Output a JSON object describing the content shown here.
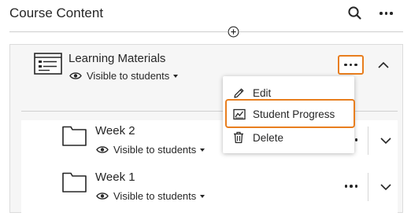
{
  "header": {
    "title": "Course Content",
    "search_icon": "search-icon",
    "more_icon": "more-options-icon"
  },
  "folder": {
    "title": "Learning Materials",
    "visibility": "Visible to students",
    "icon": "folder-content-icon",
    "expanded": true
  },
  "menu": {
    "items": [
      {
        "label": "Edit",
        "icon": "pencil-icon"
      },
      {
        "label": "Student Progress",
        "icon": "student-progress-icon",
        "highlighted": true
      },
      {
        "label": "Delete",
        "icon": "trash-icon"
      }
    ]
  },
  "items": [
    {
      "title": "Week 2",
      "visibility": "Visible to students",
      "icon": "folder-icon"
    },
    {
      "title": "Week 1",
      "visibility": "Visible to students",
      "icon": "folder-icon"
    }
  ],
  "colors": {
    "highlight": "#e87e1e",
    "text": "#262626",
    "panel_bg": "#f6f6f6",
    "border": "#dcdcdc"
  }
}
